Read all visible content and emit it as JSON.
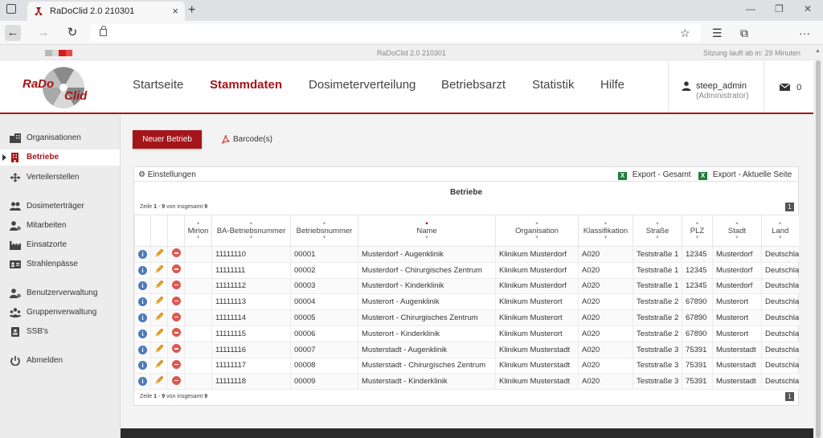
{
  "browser": {
    "tab_title": "RaDoClid 2.0 210301",
    "tab_close": "×",
    "new_tab": "+",
    "window_minimize": "—",
    "window_restore": "❐",
    "window_close": "✕",
    "more_menu": "···"
  },
  "app": {
    "title_strip": "RaDoClid 2.0 210301",
    "session": "Sitzung lauft ab in: 29 Minuten",
    "flag_colors": [
      "#b9b9b9",
      "#b9b9b9",
      "#d71b1b",
      "#d71b1b"
    ],
    "accent": "#a4151a"
  },
  "nav": {
    "items": [
      {
        "label": "Startseite",
        "active": false
      },
      {
        "label": "Stammdaten",
        "active": true
      },
      {
        "label": "Dosimeterverteilung",
        "active": false
      },
      {
        "label": "Betriebsarzt",
        "active": false
      },
      {
        "label": "Statistik",
        "active": false
      },
      {
        "label": "Hilfe",
        "active": false
      }
    ]
  },
  "user": {
    "name": "steep_admin",
    "role": "(Administrator)",
    "mail_count": "0"
  },
  "sidebar": {
    "items": [
      {
        "label": "Organisationen",
        "icon": "building-icon"
      },
      {
        "label": "Betriebe",
        "icon": "office-icon",
        "active": true
      },
      {
        "label": "Verteilerstellen",
        "icon": "arrows-icon"
      },
      {
        "label": "Dosimeterträger",
        "icon": "users-icon"
      },
      {
        "label": "Mitarbeiten",
        "icon": "user-gear-icon"
      },
      {
        "label": "Einsatzorte",
        "icon": "factory-icon"
      },
      {
        "label": "Strahlenpässe",
        "icon": "id-card-icon"
      },
      {
        "label": "Benutzerverwaltung",
        "icon": "user-cog-icon"
      },
      {
        "label": "Gruppenverwaltung",
        "icon": "group-icon"
      },
      {
        "label": "SSB's",
        "icon": "badge-icon"
      },
      {
        "label": "Abmelden",
        "icon": "power-icon"
      }
    ]
  },
  "toolbar": {
    "new_label": "Neuer Betrieb",
    "barcode_label": "Barcode(s)"
  },
  "panel": {
    "settings_label": "Einstellungen",
    "export_all": "Export - Gesamt",
    "export_page": "Export - Aktuelle Seite",
    "xls_glyph": "X",
    "table_title": "Betriebe",
    "pager": {
      "prefix": "Zeile",
      "from": "1",
      "sep": "-",
      "to": "9",
      "mid": "von insgesamt",
      "total": "9"
    },
    "page_number": "1"
  },
  "table": {
    "columns": [
      "Mirion",
      "BA-Betriebsnummer",
      "Betriebsnummer",
      "Name",
      "Organisation",
      "Klassifikation",
      "Straße",
      "PLZ",
      "Stadt",
      "Land"
    ],
    "sorted_column": "Name",
    "rows": [
      [
        "11111110",
        "00001",
        "Musterdorf - Augenklinik",
        "Klinikum Musterdorf",
        "A020",
        "Teststraße 1",
        "12345",
        "Musterdorf",
        "Deutschland"
      ],
      [
        "11111111",
        "00002",
        "Musterdorf - Chirurgisches Zentrum",
        "Klinikum Musterdorf",
        "A020",
        "Teststraße 1",
        "12345",
        "Musterdorf",
        "Deutschland"
      ],
      [
        "11111112",
        "00003",
        "Musterdorf - Kinderklinik",
        "Klinikum Musterdorf",
        "A020",
        "Teststraße 1",
        "12345",
        "Musterdorf",
        "Deutschland"
      ],
      [
        "11111113",
        "00004",
        "Musterort - Augenklinik",
        "Klinikum Musterort",
        "A020",
        "Teststraße 2",
        "67890",
        "Musterort",
        "Deutschland"
      ],
      [
        "11111114",
        "00005",
        "Musterort - Chirurgisches Zentrum",
        "Klinikum Musterort",
        "A020",
        "Teststraße 2",
        "67890",
        "Musterort",
        "Deutschland"
      ],
      [
        "11111115",
        "00006",
        "Musterort - Kinderklinik",
        "Klinikum Musterort",
        "A020",
        "Teststraße 2",
        "67890",
        "Musterort",
        "Deutschland"
      ],
      [
        "11111116",
        "00007",
        "Musterstadt - Augenklinik",
        "Klinikum Musterstadt",
        "A020",
        "Teststraße 3",
        "75391",
        "Musterstadt",
        "Deutschland"
      ],
      [
        "11111117",
        "00008",
        "Musterstadt - Chirurgisches Zentrum",
        "Klinikum Musterstadt",
        "A020",
        "Teststraße 3",
        "75391",
        "Musterstadt",
        "Deutschland"
      ],
      [
        "11111118",
        "00009",
        "Musterstadt - Kinderklinik",
        "Klinikum Musterstadt",
        "A020",
        "Teststraße 3",
        "75391",
        "Musterstadt",
        "Deutschland"
      ]
    ]
  }
}
